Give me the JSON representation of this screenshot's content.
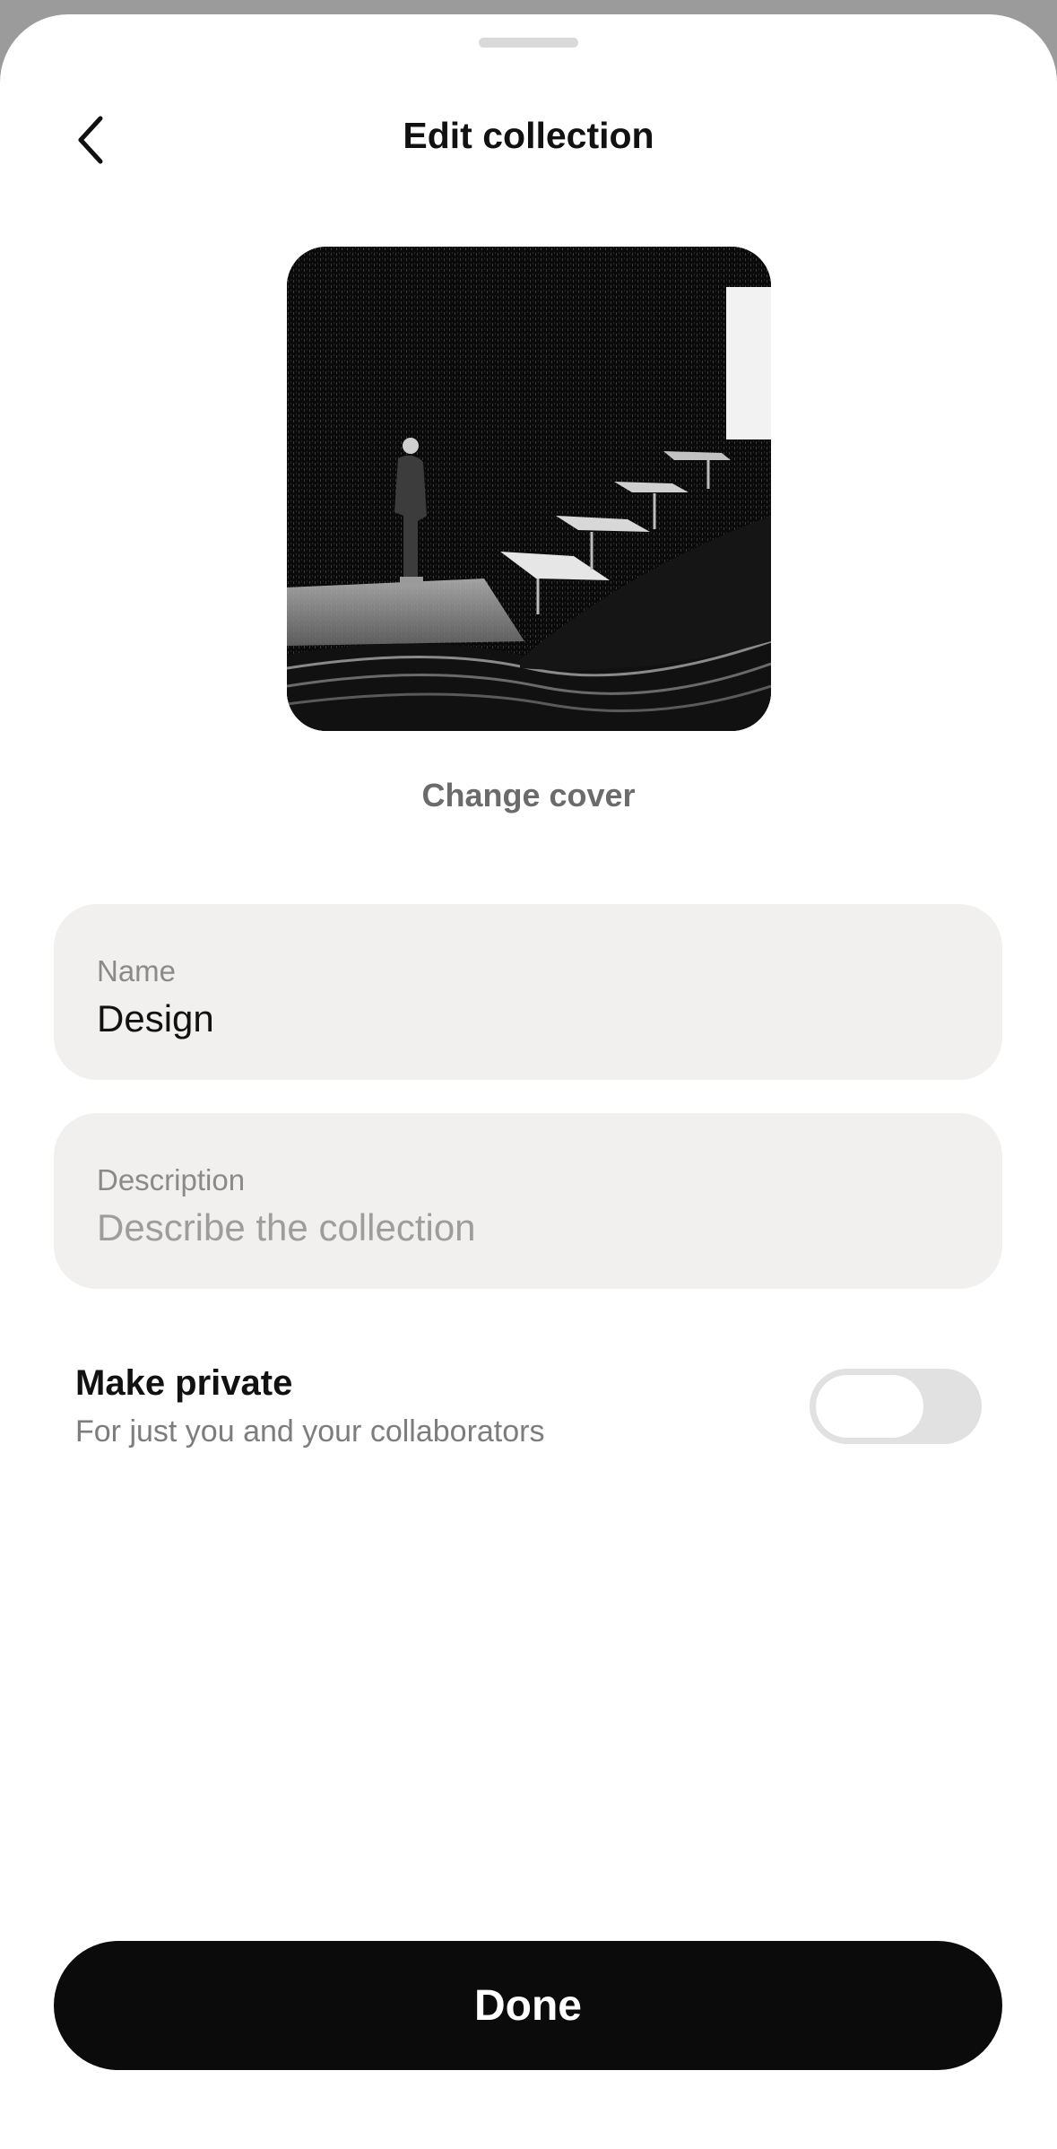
{
  "header": {
    "title": "Edit collection"
  },
  "cover": {
    "change_label": "Change cover"
  },
  "form": {
    "name": {
      "label": "Name",
      "value": "Design"
    },
    "description": {
      "label": "Description",
      "placeholder": "Describe the collection",
      "value": ""
    }
  },
  "privacy": {
    "title": "Make private",
    "subtitle": "For just you and your collaborators",
    "enabled": false
  },
  "footer": {
    "done_label": "Done"
  },
  "icons": {
    "back": "chevron-left-icon"
  },
  "colors": {
    "primary_button": "#0b0b0b",
    "field_background": "#f1f0ee",
    "toggle_off": "#e1e1e1"
  }
}
